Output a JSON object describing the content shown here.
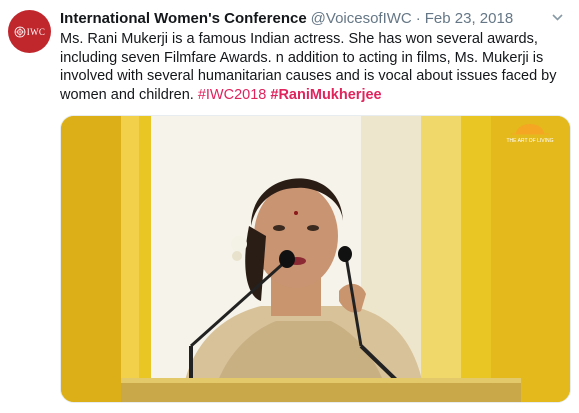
{
  "tweet": {
    "author_name": "International Women's Conference",
    "handle": "@VoicesofIWC",
    "separator": "·",
    "date": "Feb 23, 2018",
    "avatar_text": "IWC",
    "text": "Ms. Rani Mukerji is a famous Indian actress. She has won several awards, including seven Filmfare Awards. n addition to acting in films, Ms. Mukerji is involved with several humanitarian causes and is vocal about issues faced by women and children.",
    "hashtags": [
      "#IWC2018",
      "#RaniMukherjee"
    ],
    "media": {
      "watermark": "THE ART OF LIVING",
      "description_icon": "video-still-woman-speaking-at-podium"
    }
  },
  "colors": {
    "hashtag": "#e0245e",
    "avatar_bg": "#c0272d",
    "muted_text": "#657786",
    "stage_yellow": "#e8c82a"
  },
  "icons": {
    "caret": "chevron-down-icon",
    "avatar": "iwc-logo-icon"
  }
}
